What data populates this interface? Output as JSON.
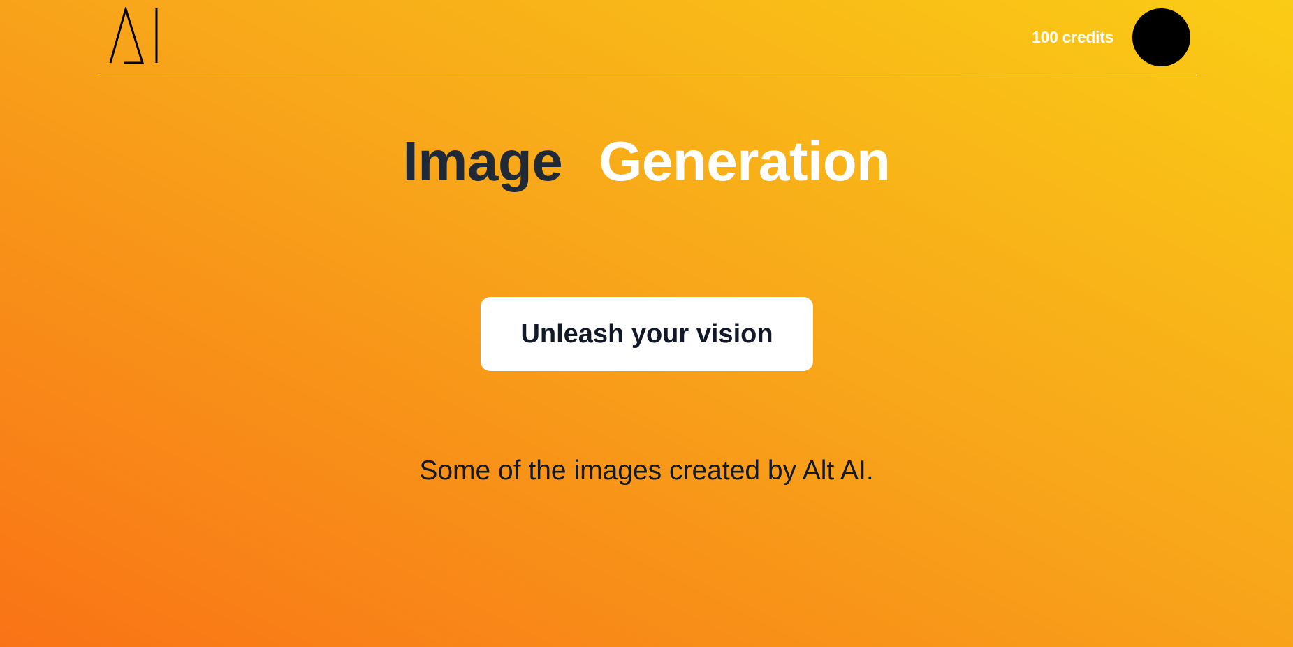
{
  "header": {
    "logo_icon": "alt-ai-logo-icon",
    "credits": "100 credits",
    "avatar_icon": "user-avatar-icon"
  },
  "hero": {
    "title_word1": "Image",
    "title_word2": "Generation",
    "cta_label": "Unleash your vision",
    "subtitle": "Some of the images created by Alt AI."
  },
  "colors": {
    "gradient_start": "#f97316",
    "gradient_end": "#facc15",
    "title_dark": "#1f2937",
    "title_light": "#ffffff",
    "button_bg": "#ffffff",
    "avatar": "#000000"
  }
}
